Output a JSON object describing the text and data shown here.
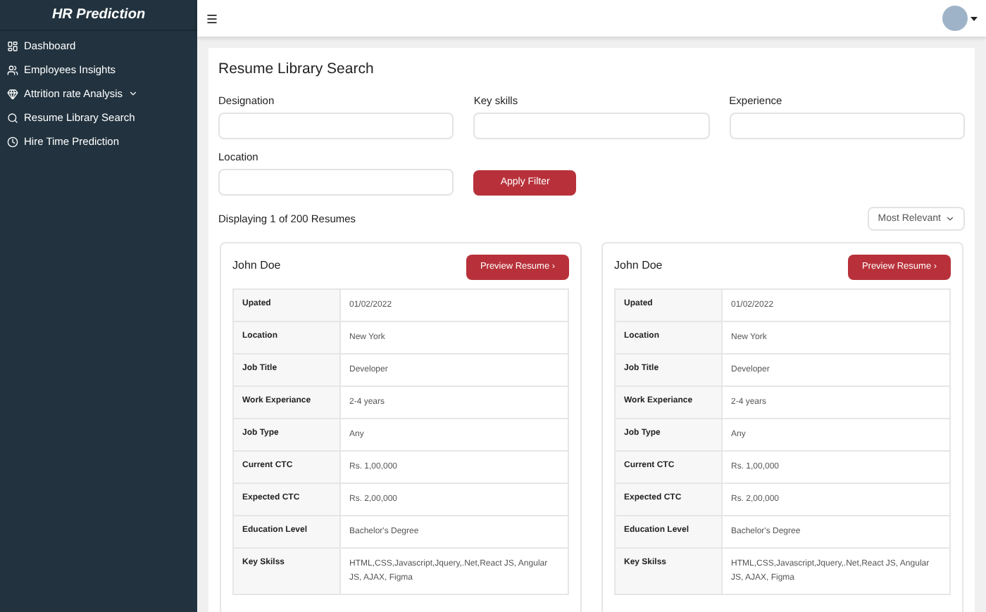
{
  "sidebar": {
    "title": "HR Prediction",
    "items": [
      {
        "label": "Dashboard",
        "has_caret": false
      },
      {
        "label": "Employees Insights",
        "has_caret": false
      },
      {
        "label": "Attrition rate Analysis",
        "has_caret": true
      },
      {
        "label": "Resume Library Search",
        "has_caret": false
      },
      {
        "label": "Hire Time Prediction",
        "has_caret": false
      }
    ]
  },
  "page": {
    "title": "Resume Library Search",
    "filters": [
      {
        "label": "Designation"
      },
      {
        "label": "Key skills"
      },
      {
        "label": "Experience"
      },
      {
        "label": "Location"
      }
    ],
    "apply_button": "Apply Filter",
    "result_count": "Displaying 1 of 200 Resumes",
    "sort": "Most Relevant",
    "resumes": [
      {
        "name": "John Doe",
        "button": "Preview Resume ›",
        "fields": [
          [
            "Upated",
            "01/02/2022"
          ],
          [
            "Location",
            "New York"
          ],
          [
            "Job Title",
            "Developer"
          ],
          [
            "Work Experiance",
            "2-4 years"
          ],
          [
            "Job Type",
            "Any"
          ],
          [
            "Current CTC",
            "Rs. 1,00,000"
          ],
          [
            "Expected CTC",
            "Rs. 2,00,000"
          ],
          [
            "Education Level",
            "Bachelor's Degree"
          ],
          [
            "Key Skilss",
            "HTML,CSS,Javascript,Jquery,.Net,React JS, Angular JS, AJAX, Figma"
          ]
        ]
      },
      {
        "name": "John Doe",
        "button": "Preview Resume ›",
        "fields": [
          [
            "Upated",
            "01/02/2022"
          ],
          [
            "Location",
            "New York"
          ],
          [
            "Job Title",
            "Developer"
          ],
          [
            "Work Experiance",
            "2-4 years"
          ],
          [
            "Job Type",
            "Any"
          ],
          [
            "Current CTC",
            "Rs. 1,00,000"
          ],
          [
            "Expected CTC",
            "Rs. 2,00,000"
          ],
          [
            "Education Level",
            "Bachelor's Degree"
          ],
          [
            "Key Skilss",
            "HTML,CSS,Javascript,Jquery,.Net,React JS, Angular JS, AJAX, Figma"
          ]
        ]
      }
    ]
  }
}
